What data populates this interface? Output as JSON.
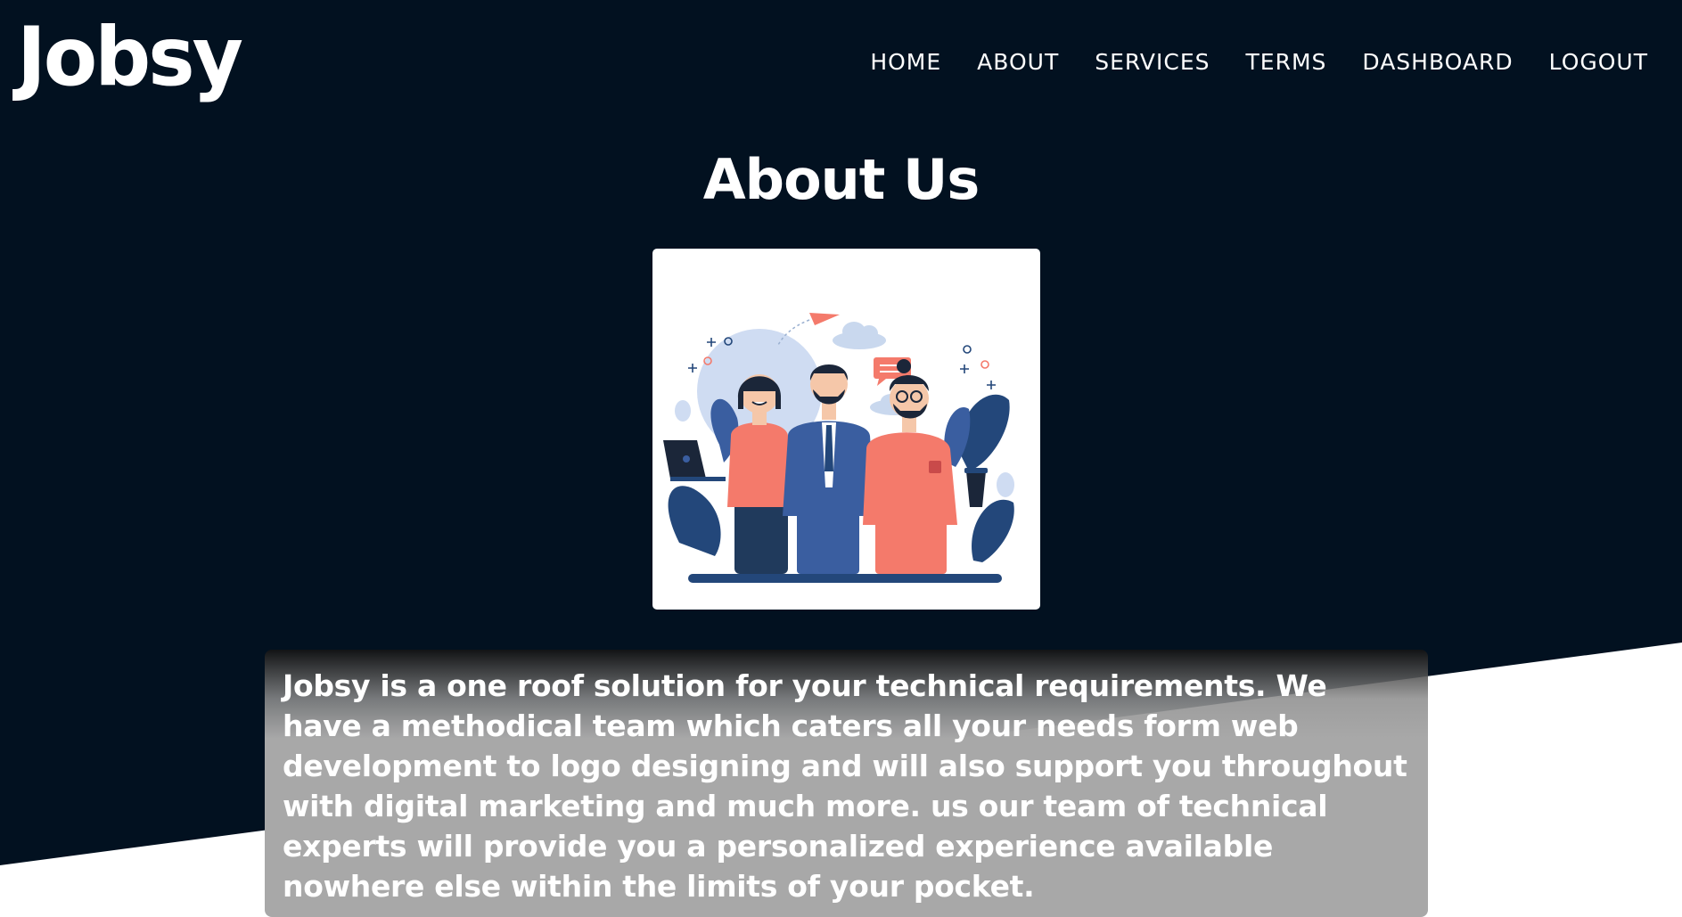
{
  "brand": {
    "logo": "Jobsy"
  },
  "nav": {
    "items": [
      "HOME",
      "ABOUT",
      "SERVICES",
      "TERMS",
      "DASHBOARD",
      "LOGOUT"
    ]
  },
  "page": {
    "title": "About Us",
    "description": "Jobsy is a one roof solution for your technical requirements. We have a methodical team which caters all your needs form web development to logo designing and will also support you throughout with digital marketing and much more. us our team of technical experts will provide you a personalized experience available nowhere else within the limits of your pocket."
  },
  "colors": {
    "background_dark": "#021120",
    "background_light": "#ffffff",
    "text": "#ffffff",
    "text_box": "#a8a8a8",
    "illustration_coral": "#f47a6b",
    "illustration_navy": "#23477a"
  }
}
